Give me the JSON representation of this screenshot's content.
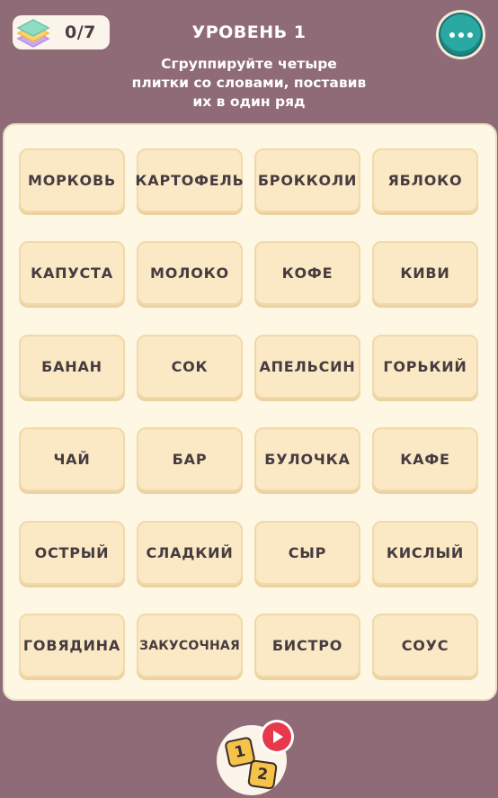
{
  "header": {
    "progress": "0/7",
    "level_title": "УРОВЕНЬ 1",
    "instructions": [
      "Сгруппируйте четыре",
      "плитки со словами, поставив",
      "их в один ряд"
    ],
    "menu_icon": "more-dots-icon",
    "progress_icon": "layers-stack-icon"
  },
  "board": {
    "rows": [
      [
        "МОРКОВЬ",
        "КАРТОФЕЛЬ",
        "БРОККОЛИ",
        "ЯБЛОКО"
      ],
      [
        "КАПУСТА",
        "МОЛОКО",
        "КОФЕ",
        "КИВИ"
      ],
      [
        "БАНАН",
        "СОК",
        "АПЕЛЬСИН",
        "ГОРЬКИЙ"
      ],
      [
        "ЧАЙ",
        "БАР",
        "БУЛОЧКА",
        "КАФЕ"
      ],
      [
        "ОСТРЫЙ",
        "СЛАДКИЙ",
        "СЫР",
        "КИСЛЫЙ"
      ],
      [
        "ГОВЯДИНА",
        "ЗАКУСОЧНАЯ",
        "БИСТРО",
        "СОУС"
      ]
    ]
  },
  "footer": {
    "hint_cards": [
      "1",
      "2"
    ],
    "hint_icon": "numbered-cards-icon",
    "play_icon": "play-video-icon"
  },
  "colors": {
    "background": "#8f6b77",
    "board": "#fdf7e4",
    "tile": "#fbe9c5",
    "menu_button": "#2aa9a4",
    "play_badge": "#e8384b",
    "hint_card": "#f6c34a"
  }
}
